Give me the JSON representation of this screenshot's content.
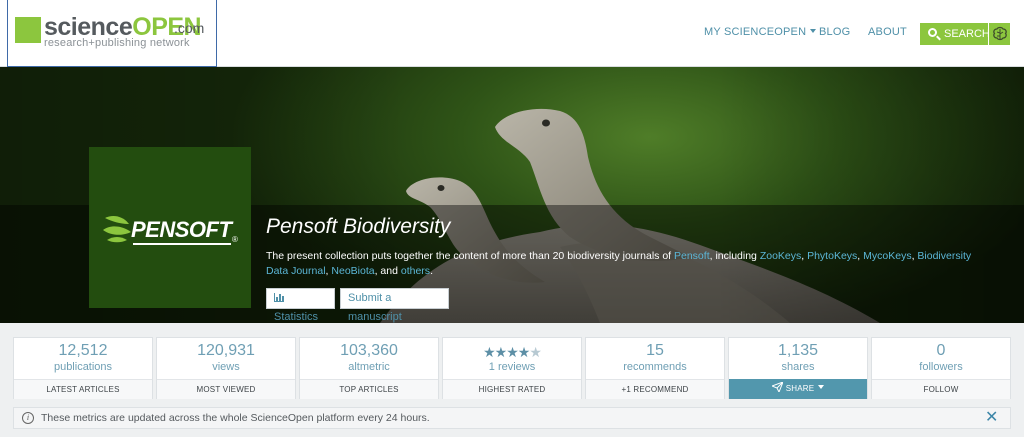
{
  "header": {
    "logo": {
      "science": "science",
      "open": "OPEN",
      "com": ".com",
      "tagline": "research+publishing network"
    },
    "nav": {
      "my": "MY SCIENCEOPEN",
      "blog": "BLOG",
      "about": "ABOUT",
      "search": "SEARCH"
    }
  },
  "collection": {
    "logo_text": "PENSOFT",
    "logo_reg": "®",
    "title": "Pensoft Biodiversity",
    "desc": {
      "t1": "The present collection puts together the content of more than 20 biodiversity journals of ",
      "l1": "Pensoft",
      "t2": ", including ",
      "l2": "ZooKeys",
      "t3": ", ",
      "l3": "PhytoKeys",
      "t4": ", ",
      "l4": "MycoKeys",
      "t5": ", ",
      "l5": "Biodiversity Data Journal",
      "t6": ", ",
      "l6": "NeoBiota",
      "t7": ", and ",
      "l7": "others",
      "t8": "."
    },
    "buttons": {
      "statistics": "Statistics",
      "submit": "Submit a manuscript"
    }
  },
  "metrics": [
    {
      "value": "12,512",
      "label": "publications",
      "action": "LATEST ARTICLES"
    },
    {
      "value": "120,931",
      "label": "views",
      "action": "MOST VIEWED"
    },
    {
      "value": "103,360",
      "label": "altmetric",
      "action": "TOP ARTICLES"
    },
    {
      "rating": 4.5,
      "stars_full": "★★★★",
      "stars_half": "★",
      "label": "1 reviews",
      "action": "HIGHEST RATED"
    },
    {
      "value": "15",
      "label": "recommends",
      "action": "+1 RECOMMEND"
    },
    {
      "value": "1,135",
      "label": "shares",
      "action": "SHARE"
    },
    {
      "value": "0",
      "label": "followers",
      "action": "FOLLOW"
    }
  ],
  "info": {
    "text": "These metrics are updated across the whole ScienceOpen platform every 24 hours.",
    "close": "✕"
  },
  "colors": {
    "accent_green": "#8cc63e",
    "link_blue": "#4f90a8",
    "share_bg": "#5297ad",
    "pensoft_green": "#234d0f"
  }
}
